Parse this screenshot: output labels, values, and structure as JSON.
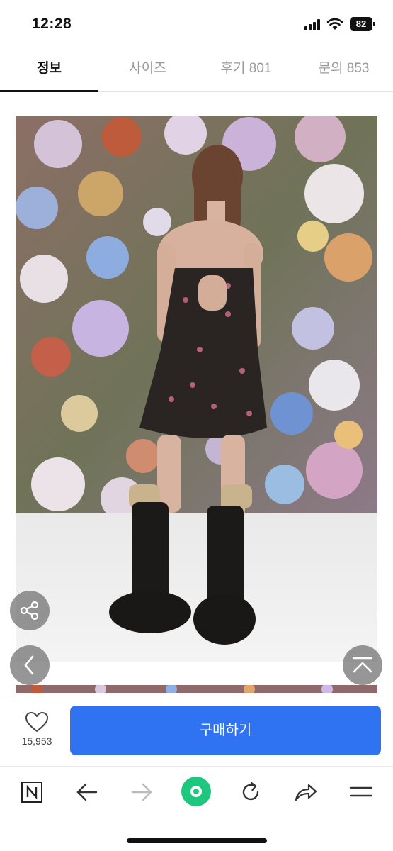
{
  "status_bar": {
    "time": "12:28",
    "battery": "82",
    "icons": [
      "signal-icon",
      "wifi-icon",
      "battery-icon"
    ]
  },
  "tabs": [
    {
      "label": "정보",
      "active": true
    },
    {
      "label": "사이즈",
      "active": false
    },
    {
      "label": "후기 801",
      "active": false
    },
    {
      "label": "문의 853",
      "active": false
    }
  ],
  "product_image": {
    "description_icon": "product-photo"
  },
  "floating_buttons": {
    "share": "share-icon",
    "prev": "chevron-left-icon",
    "top": "scroll-top-icon"
  },
  "purchase_bar": {
    "like_count": "15,953",
    "like_icon": "heart-icon",
    "buy_label": "구매하기"
  },
  "browser_toolbar": {
    "items": [
      "naver-icon",
      "back-arrow-icon",
      "forward-arrow-icon",
      "green-dot-icon",
      "reload-icon",
      "share-arrow-icon",
      "menu-icon"
    ]
  },
  "colors": {
    "accent": "#2f73f2",
    "green": "#1ec77e",
    "tab_active": "#111111",
    "tab_inactive": "#9a9a9a"
  }
}
